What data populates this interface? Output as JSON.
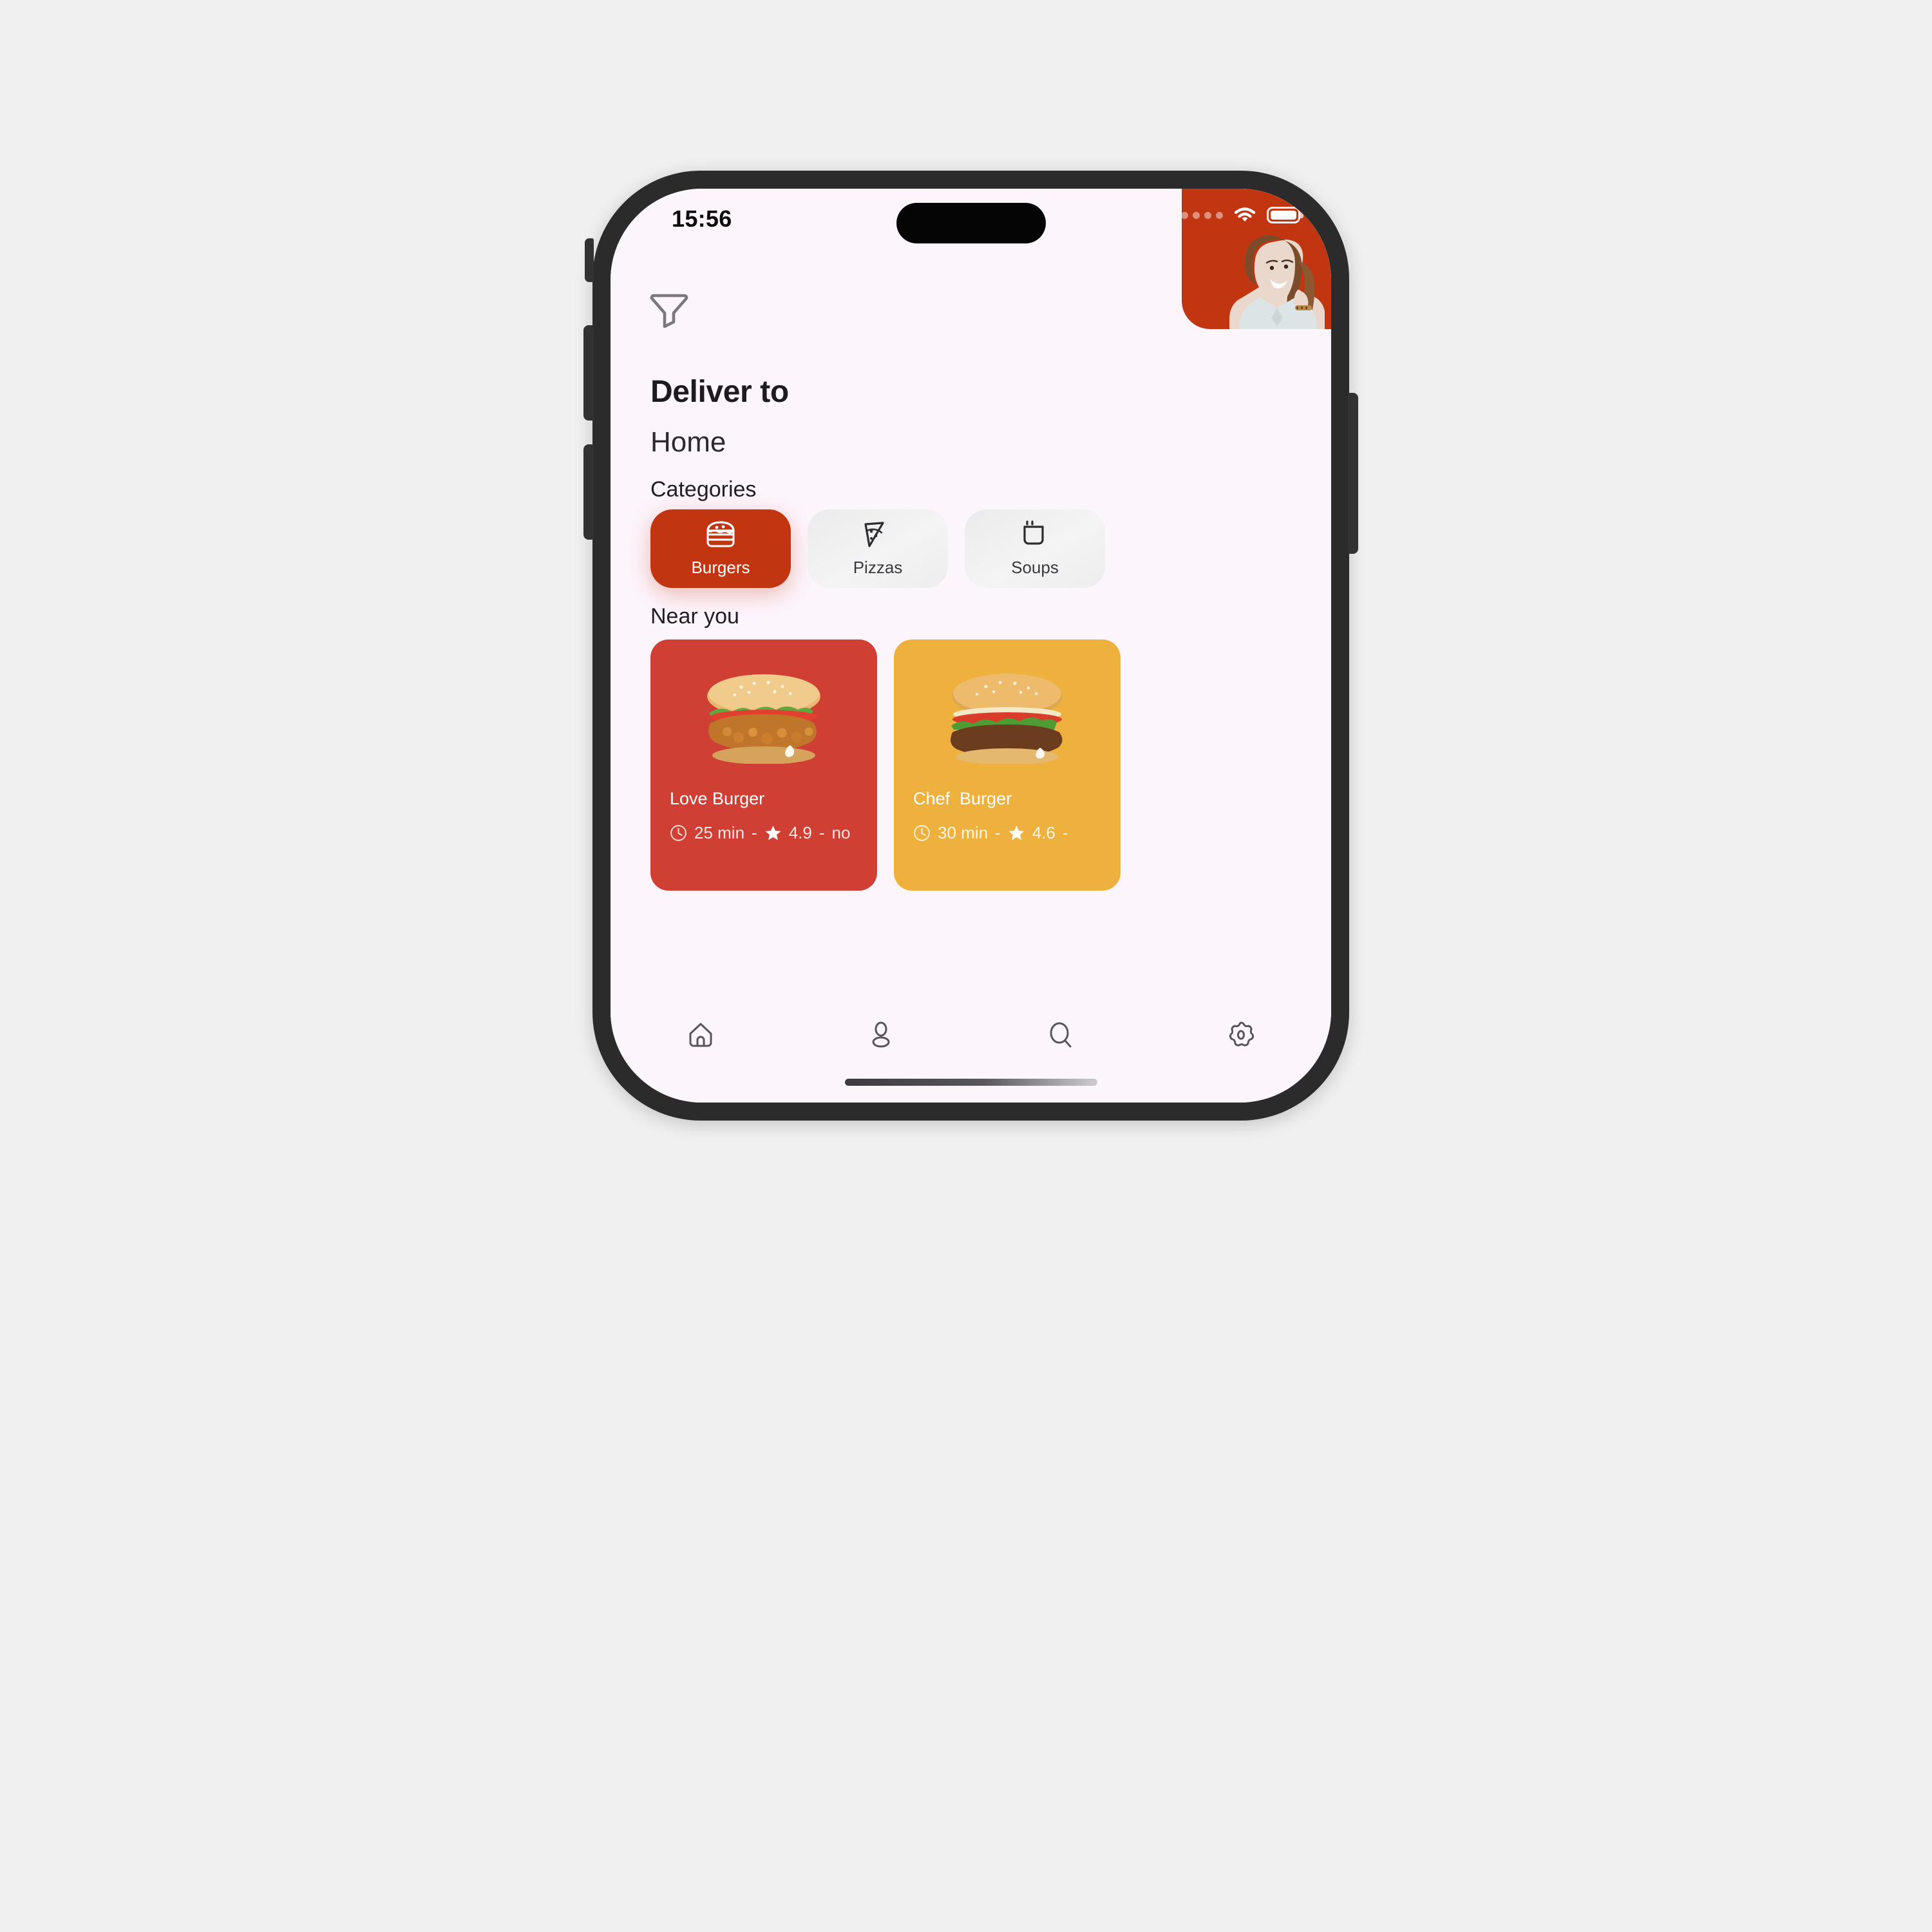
{
  "device": {
    "frame_color": "#2b2b2b",
    "screen_bg": "#fdf5fc",
    "buttons": [
      "silent-switch",
      "volume-up",
      "volume-down",
      "power"
    ]
  },
  "status_bar": {
    "time": "15:56",
    "signal_icon": "signal-dots-icon",
    "wifi_icon": "wifi-icon",
    "battery_icon": "battery-full-icon",
    "battery_level": "100"
  },
  "header": {
    "filter_icon": "filter-funnel-icon",
    "avatar": {
      "name": "avatar",
      "bg_color": "#c13610"
    }
  },
  "deliver": {
    "title": "Deliver to",
    "value": "Home"
  },
  "categories": {
    "title": "Categories",
    "accent_color": "#c13610",
    "items": [
      {
        "label": "Burgers",
        "icon": "burger-icon",
        "active": true
      },
      {
        "label": "Pizzas",
        "icon": "pizza-slice-icon",
        "active": false
      },
      {
        "label": "Soups",
        "icon": "soup-cup-icon",
        "active": false
      }
    ]
  },
  "near_you": {
    "title": "Near you",
    "restaurants": [
      {
        "name": "Love Burger",
        "time": "25 min",
        "rating": "4.9",
        "extra": "no",
        "separator": "-",
        "bg_color": "#cf3f34",
        "image": "crispy-chicken-burger-image",
        "clock_icon": "clock-icon",
        "star_icon": "star-icon"
      },
      {
        "name": "Chef  Burger",
        "time": "30 min",
        "rating": "4.6",
        "extra": "",
        "separator": "-",
        "bg_color": "#efb13e",
        "image": "beef-burger-image",
        "clock_icon": "clock-icon",
        "star_icon": "star-icon"
      }
    ]
  },
  "tabbar": {
    "items": [
      {
        "name": "home",
        "icon": "home-icon"
      },
      {
        "name": "profile",
        "icon": "person-icon"
      },
      {
        "name": "search",
        "icon": "search-icon"
      },
      {
        "name": "settings",
        "icon": "gear-icon"
      }
    ]
  }
}
